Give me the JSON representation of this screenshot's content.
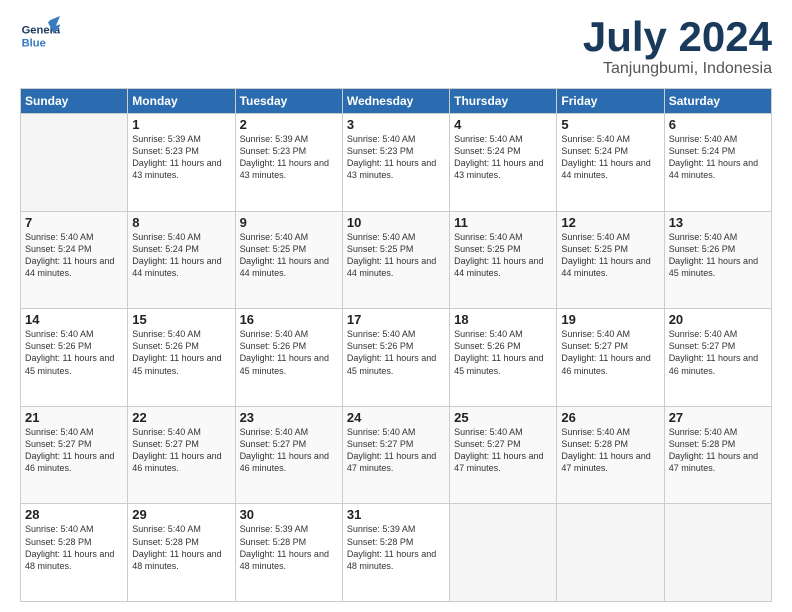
{
  "header": {
    "logo_general": "General",
    "logo_blue": "Blue",
    "month": "July 2024",
    "location": "Tanjungbumi, Indonesia"
  },
  "days_of_week": [
    "Sunday",
    "Monday",
    "Tuesday",
    "Wednesday",
    "Thursday",
    "Friday",
    "Saturday"
  ],
  "weeks": [
    [
      {
        "day": "",
        "sunrise": "",
        "sunset": "",
        "daylight": ""
      },
      {
        "day": "1",
        "sunrise": "Sunrise: 5:39 AM",
        "sunset": "Sunset: 5:23 PM",
        "daylight": "Daylight: 11 hours and 43 minutes."
      },
      {
        "day": "2",
        "sunrise": "Sunrise: 5:39 AM",
        "sunset": "Sunset: 5:23 PM",
        "daylight": "Daylight: 11 hours and 43 minutes."
      },
      {
        "day": "3",
        "sunrise": "Sunrise: 5:40 AM",
        "sunset": "Sunset: 5:23 PM",
        "daylight": "Daylight: 11 hours and 43 minutes."
      },
      {
        "day": "4",
        "sunrise": "Sunrise: 5:40 AM",
        "sunset": "Sunset: 5:24 PM",
        "daylight": "Daylight: 11 hours and 43 minutes."
      },
      {
        "day": "5",
        "sunrise": "Sunrise: 5:40 AM",
        "sunset": "Sunset: 5:24 PM",
        "daylight": "Daylight: 11 hours and 44 minutes."
      },
      {
        "day": "6",
        "sunrise": "Sunrise: 5:40 AM",
        "sunset": "Sunset: 5:24 PM",
        "daylight": "Daylight: 11 hours and 44 minutes."
      }
    ],
    [
      {
        "day": "7",
        "sunrise": "Sunrise: 5:40 AM",
        "sunset": "Sunset: 5:24 PM",
        "daylight": "Daylight: 11 hours and 44 minutes."
      },
      {
        "day": "8",
        "sunrise": "Sunrise: 5:40 AM",
        "sunset": "Sunset: 5:24 PM",
        "daylight": "Daylight: 11 hours and 44 minutes."
      },
      {
        "day": "9",
        "sunrise": "Sunrise: 5:40 AM",
        "sunset": "Sunset: 5:25 PM",
        "daylight": "Daylight: 11 hours and 44 minutes."
      },
      {
        "day": "10",
        "sunrise": "Sunrise: 5:40 AM",
        "sunset": "Sunset: 5:25 PM",
        "daylight": "Daylight: 11 hours and 44 minutes."
      },
      {
        "day": "11",
        "sunrise": "Sunrise: 5:40 AM",
        "sunset": "Sunset: 5:25 PM",
        "daylight": "Daylight: 11 hours and 44 minutes."
      },
      {
        "day": "12",
        "sunrise": "Sunrise: 5:40 AM",
        "sunset": "Sunset: 5:25 PM",
        "daylight": "Daylight: 11 hours and 44 minutes."
      },
      {
        "day": "13",
        "sunrise": "Sunrise: 5:40 AM",
        "sunset": "Sunset: 5:26 PM",
        "daylight": "Daylight: 11 hours and 45 minutes."
      }
    ],
    [
      {
        "day": "14",
        "sunrise": "Sunrise: 5:40 AM",
        "sunset": "Sunset: 5:26 PM",
        "daylight": "Daylight: 11 hours and 45 minutes."
      },
      {
        "day": "15",
        "sunrise": "Sunrise: 5:40 AM",
        "sunset": "Sunset: 5:26 PM",
        "daylight": "Daylight: 11 hours and 45 minutes."
      },
      {
        "day": "16",
        "sunrise": "Sunrise: 5:40 AM",
        "sunset": "Sunset: 5:26 PM",
        "daylight": "Daylight: 11 hours and 45 minutes."
      },
      {
        "day": "17",
        "sunrise": "Sunrise: 5:40 AM",
        "sunset": "Sunset: 5:26 PM",
        "daylight": "Daylight: 11 hours and 45 minutes."
      },
      {
        "day": "18",
        "sunrise": "Sunrise: 5:40 AM",
        "sunset": "Sunset: 5:26 PM",
        "daylight": "Daylight: 11 hours and 45 minutes."
      },
      {
        "day": "19",
        "sunrise": "Sunrise: 5:40 AM",
        "sunset": "Sunset: 5:27 PM",
        "daylight": "Daylight: 11 hours and 46 minutes."
      },
      {
        "day": "20",
        "sunrise": "Sunrise: 5:40 AM",
        "sunset": "Sunset: 5:27 PM",
        "daylight": "Daylight: 11 hours and 46 minutes."
      }
    ],
    [
      {
        "day": "21",
        "sunrise": "Sunrise: 5:40 AM",
        "sunset": "Sunset: 5:27 PM",
        "daylight": "Daylight: 11 hours and 46 minutes."
      },
      {
        "day": "22",
        "sunrise": "Sunrise: 5:40 AM",
        "sunset": "Sunset: 5:27 PM",
        "daylight": "Daylight: 11 hours and 46 minutes."
      },
      {
        "day": "23",
        "sunrise": "Sunrise: 5:40 AM",
        "sunset": "Sunset: 5:27 PM",
        "daylight": "Daylight: 11 hours and 46 minutes."
      },
      {
        "day": "24",
        "sunrise": "Sunrise: 5:40 AM",
        "sunset": "Sunset: 5:27 PM",
        "daylight": "Daylight: 11 hours and 47 minutes."
      },
      {
        "day": "25",
        "sunrise": "Sunrise: 5:40 AM",
        "sunset": "Sunset: 5:27 PM",
        "daylight": "Daylight: 11 hours and 47 minutes."
      },
      {
        "day": "26",
        "sunrise": "Sunrise: 5:40 AM",
        "sunset": "Sunset: 5:28 PM",
        "daylight": "Daylight: 11 hours and 47 minutes."
      },
      {
        "day": "27",
        "sunrise": "Sunrise: 5:40 AM",
        "sunset": "Sunset: 5:28 PM",
        "daylight": "Daylight: 11 hours and 47 minutes."
      }
    ],
    [
      {
        "day": "28",
        "sunrise": "Sunrise: 5:40 AM",
        "sunset": "Sunset: 5:28 PM",
        "daylight": "Daylight: 11 hours and 48 minutes."
      },
      {
        "day": "29",
        "sunrise": "Sunrise: 5:40 AM",
        "sunset": "Sunset: 5:28 PM",
        "daylight": "Daylight: 11 hours and 48 minutes."
      },
      {
        "day": "30",
        "sunrise": "Sunrise: 5:39 AM",
        "sunset": "Sunset: 5:28 PM",
        "daylight": "Daylight: 11 hours and 48 minutes."
      },
      {
        "day": "31",
        "sunrise": "Sunrise: 5:39 AM",
        "sunset": "Sunset: 5:28 PM",
        "daylight": "Daylight: 11 hours and 48 minutes."
      },
      {
        "day": "",
        "sunrise": "",
        "sunset": "",
        "daylight": ""
      },
      {
        "day": "",
        "sunrise": "",
        "sunset": "",
        "daylight": ""
      },
      {
        "day": "",
        "sunrise": "",
        "sunset": "",
        "daylight": ""
      }
    ]
  ]
}
